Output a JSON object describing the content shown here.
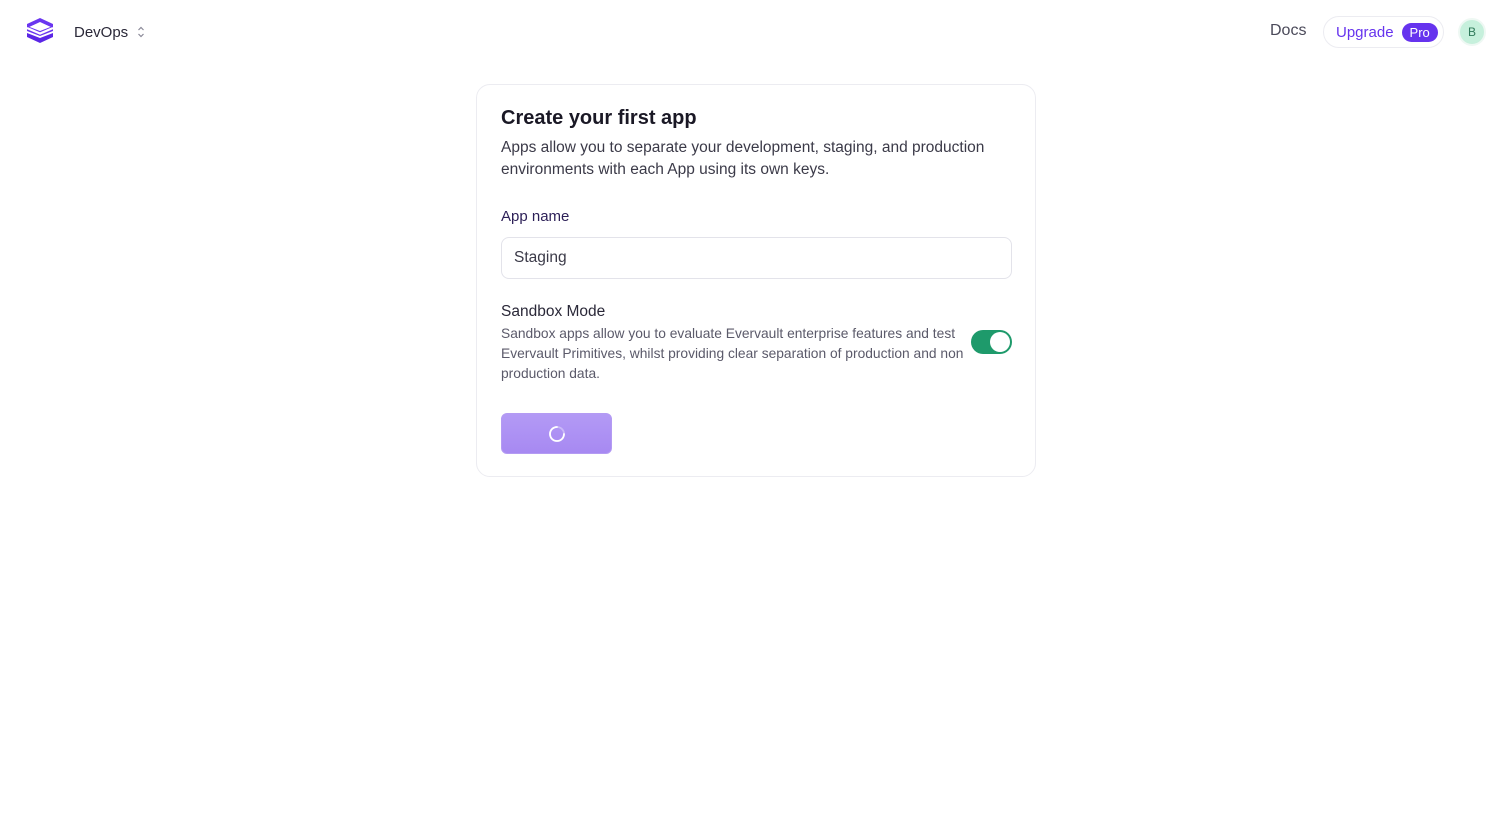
{
  "header": {
    "workspace_name": "DevOps",
    "docs_label": "Docs",
    "upgrade_label": "Upgrade",
    "pro_badge": "Pro",
    "avatar_initial": "B"
  },
  "form": {
    "title": "Create your first app",
    "description": "Apps allow you to separate your development, staging, and production environments with each App using its own keys.",
    "app_name_label": "App name",
    "app_name_value": "Staging",
    "sandbox_title": "Sandbox Mode",
    "sandbox_description": "Sandbox apps allow you to evaluate Evervault enterprise features and test Evervault Primitives, whilst providing clear separation of production and non production data.",
    "sandbox_enabled": true,
    "submit_state": "loading"
  },
  "colors": {
    "brand": "#6633ee",
    "toggle_on": "#1e9a6b",
    "button_loading": "#a98cf2"
  },
  "icons": {
    "logo": "evervault-logo-icon",
    "workspace_switcher": "chevron-up-down-icon",
    "submit_spinner": "spinner-icon"
  }
}
